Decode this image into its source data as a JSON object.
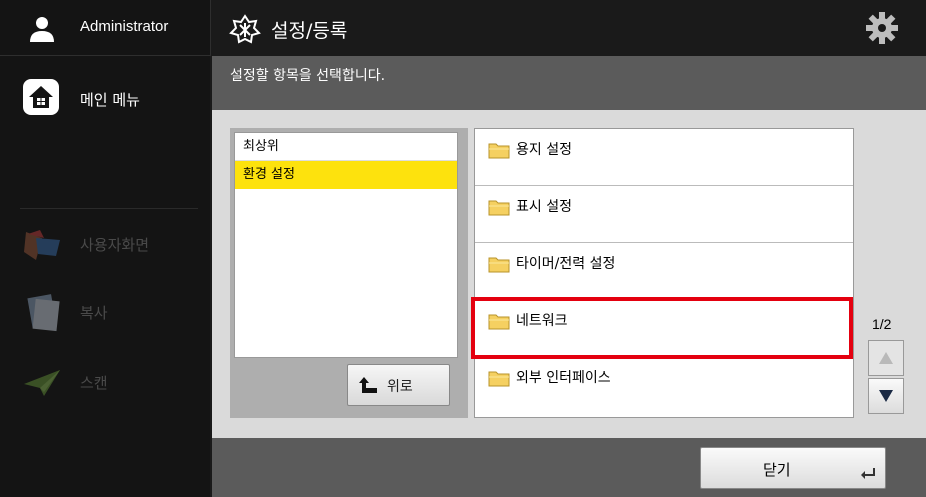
{
  "sidebar": {
    "user": {
      "name": "Administrator",
      "icon": "user-icon"
    },
    "main_menu": {
      "label": "메인 메뉴",
      "icon": "home-icon"
    },
    "apps": [
      {
        "label": "사용자화면",
        "icon": "personal-screen-icon"
      },
      {
        "label": "복사",
        "icon": "copy-icon"
      },
      {
        "label": "스캔",
        "icon": "scan-icon"
      }
    ]
  },
  "header": {
    "title": "설정/등록",
    "icon": "settings-register-icon",
    "gear_icon": "gear-icon"
  },
  "instruction": "설정할 항목을 선택합니다.",
  "tree": {
    "items": [
      {
        "label": "최상위",
        "selected": false
      },
      {
        "label": "환경 설정",
        "selected": true
      }
    ],
    "up_button": "위로"
  },
  "list": {
    "items": [
      {
        "label": "용지 설정",
        "highlighted": false
      },
      {
        "label": "표시 설정",
        "highlighted": false
      },
      {
        "label": "타이머/전력 설정",
        "highlighted": false
      },
      {
        "label": "네트워크",
        "highlighted": true
      },
      {
        "label": "외부 인터페이스",
        "highlighted": false
      }
    ]
  },
  "pager": {
    "page": "1/2"
  },
  "footer": {
    "close_label": "닫기"
  },
  "colors": {
    "selected": "#fde20d",
    "highlight": "#e4000f",
    "background": "#dadada"
  }
}
